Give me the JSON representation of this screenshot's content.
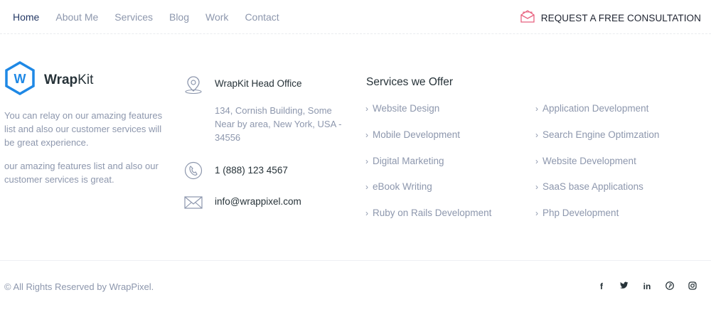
{
  "nav": {
    "links": [
      "Home",
      "About Me",
      "Services",
      "Blog",
      "Work",
      "Contact"
    ],
    "cta_label": "REQUEST A FREE CONSULTATION",
    "cta_icon": "envelope-open-icon",
    "accent": "#263a66"
  },
  "brand": {
    "name_bold": "Wrap",
    "name_light": "Kit",
    "logo_color": "#1e88e5",
    "about_1": "You can relay on our amazing features list and also our customer services will be great experience.",
    "about_2": "our amazing features list and also our customer services is great."
  },
  "contact": {
    "office_title": "WrapKit Head Office",
    "address": "134, Cornish Building, Some Near by area, New York, USA - 34556",
    "phone": "1 (888) 123 4567",
    "email": "info@wrappixel.com",
    "icons": [
      "map-pin-icon",
      "phone-icon",
      "envelope-icon"
    ]
  },
  "services": {
    "title": "Services we Offer",
    "col1": [
      "Website Design",
      "Mobile Development",
      "Digital Marketing",
      "eBook Writing",
      "Ruby on Rails Development"
    ],
    "col2": [
      "Application Development",
      "Search Engine Optimzation",
      "Website Development",
      "SaaS base Applications",
      "Php Development"
    ]
  },
  "footer": {
    "copyright": "© All Rights Reserved by WrapPixel.",
    "social": [
      "f",
      "t",
      "in",
      "p",
      "ig"
    ],
    "social_icons": [
      "facebook-icon",
      "twitter-icon",
      "linkedin-icon",
      "pinterest-icon",
      "instagram-icon"
    ]
  }
}
